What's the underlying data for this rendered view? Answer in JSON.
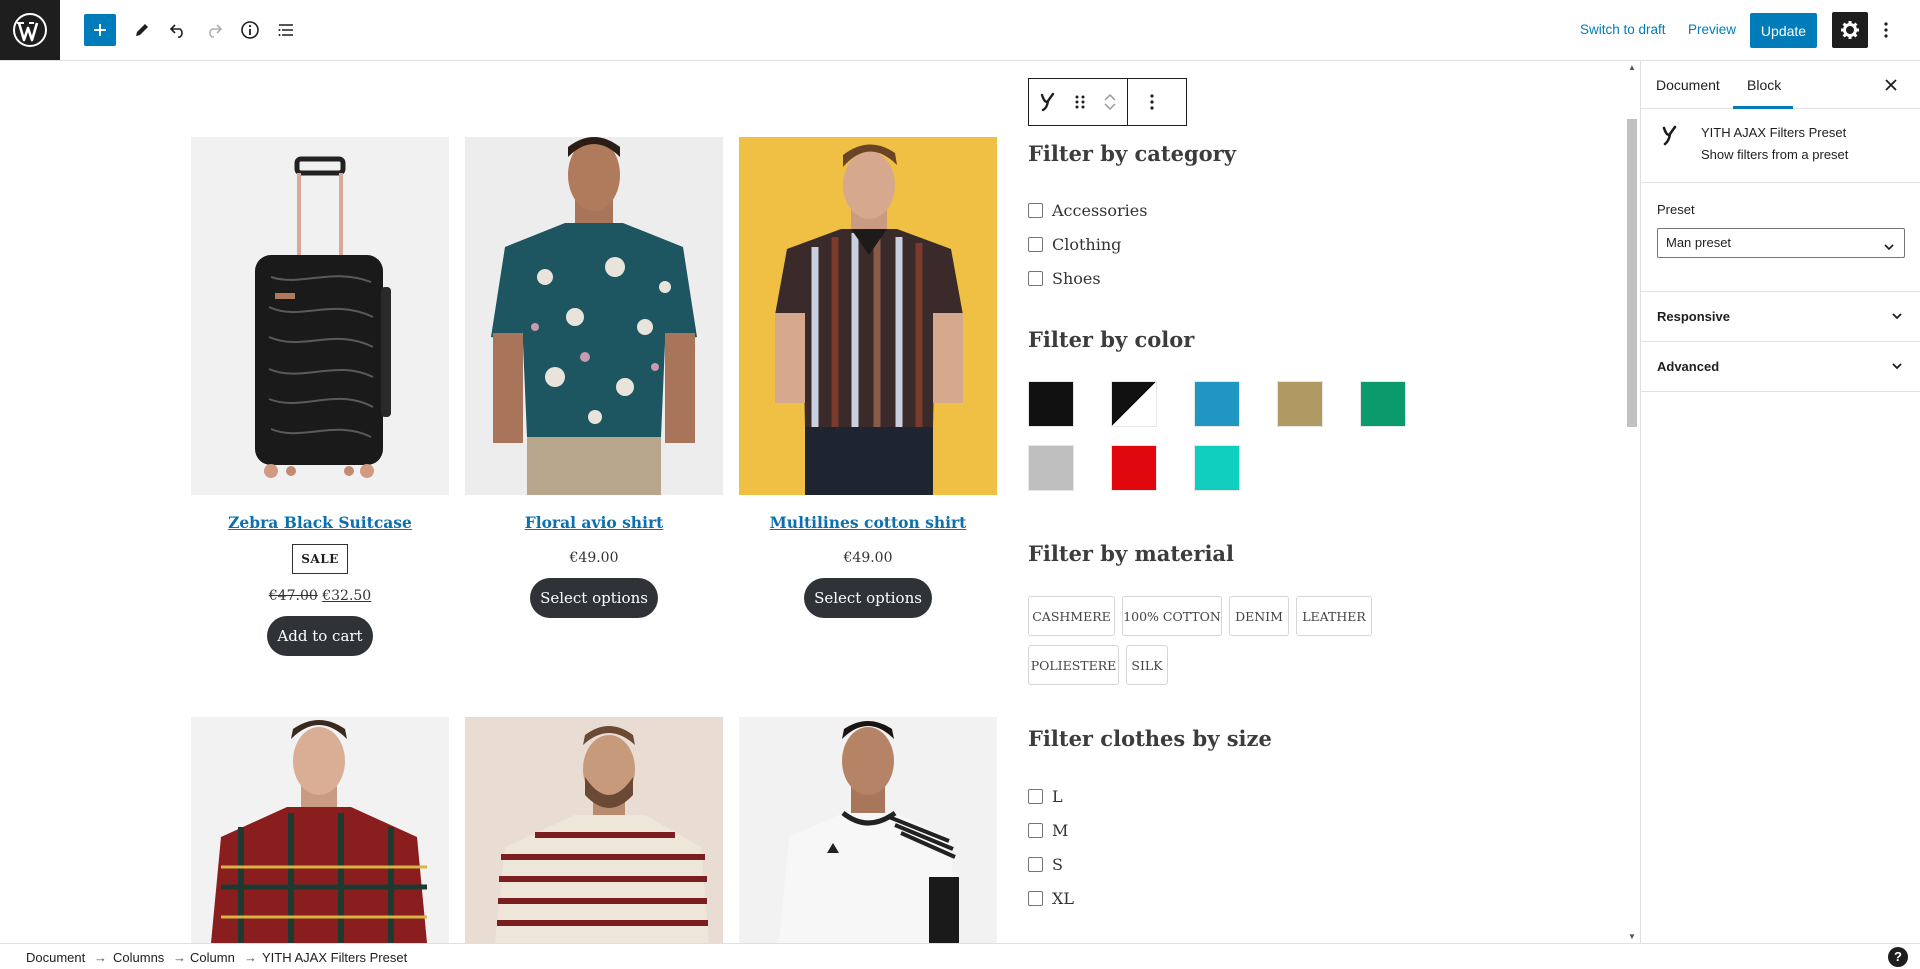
{
  "toolbar": {
    "switch_to_draft": "Switch to draft",
    "preview": "Preview",
    "update": "Update"
  },
  "block_toolbar": {
    "block_icon": "yith-y-icon"
  },
  "products": [
    {
      "title": "Zebra Black Suitcase",
      "sale_badge": "SALE",
      "price_old": "€47.00",
      "price": "€32.50",
      "button": "Add to cart"
    },
    {
      "title": "Floral avio shirt",
      "price": "€49.00",
      "button": "Select options"
    },
    {
      "title": "Multilines cotton shirt",
      "price": "€49.00",
      "button": "Select options"
    }
  ],
  "filters": {
    "category": {
      "title": "Filter by category",
      "options": [
        "Accessories",
        "Clothing",
        "Shoes"
      ]
    },
    "color": {
      "title": "Filter by color",
      "swatches": [
        "#111111",
        "black-white",
        "#1f97c2",
        "#b19964",
        "#0a9a6b",
        "#bfbfbf",
        "#e0080e",
        "#10cfbf"
      ]
    },
    "material": {
      "title": "Filter by material",
      "tags": [
        "CASHMERE",
        "100% COTTON",
        "DENIM",
        "LEATHER",
        "POLIESTERE",
        "SILK"
      ]
    },
    "size": {
      "title": "Filter clothes by size",
      "options": [
        "L",
        "M",
        "S",
        "XL"
      ]
    }
  },
  "sidebar": {
    "tabs": [
      "Document",
      "Block"
    ],
    "active_tab": "Block",
    "block_title": "YITH AJAX Filters Preset",
    "block_desc": "Show filters from a preset",
    "preset_label": "Preset",
    "preset_value": "Man preset",
    "panels": [
      "Responsive",
      "Advanced"
    ]
  },
  "breadcrumb": [
    "Document",
    "Columns",
    "Column",
    "YITH AJAX Filters Preset"
  ],
  "breadcrumb_separator": "→",
  "help_label": "?",
  "colors": {
    "accent": "#007cba",
    "dark": "#1e1e1e",
    "button": "#2f3337"
  }
}
